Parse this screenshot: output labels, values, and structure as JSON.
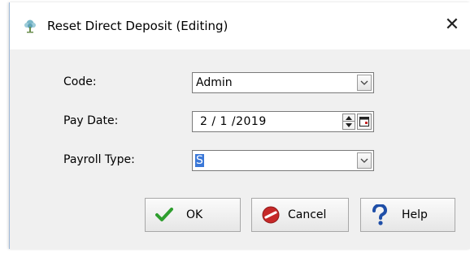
{
  "dialog": {
    "title": "Reset Direct Deposit (Editing)",
    "close_glyph": "✕",
    "title_icon": "tree-icon"
  },
  "form": {
    "code": {
      "label": "Code:",
      "value": "Admin"
    },
    "pay_date": {
      "label": "Pay Date:",
      "value": "2 / 1 /2019"
    },
    "payroll_type": {
      "label": "Payroll Type:",
      "value": "S"
    }
  },
  "buttons": {
    "ok": {
      "label": "OK",
      "icon": "checkmark-icon"
    },
    "cancel": {
      "label": "Cancel",
      "icon": "cancel-icon"
    },
    "help": {
      "label": "Help",
      "icon": "question-icon"
    }
  },
  "colors": {
    "ok_green": "#2e9e2e",
    "cancel_red": "#c62828",
    "help_blue": "#1f4fa8",
    "selection": "#3b78d8",
    "dialog_bg": "#f0f0f0"
  }
}
